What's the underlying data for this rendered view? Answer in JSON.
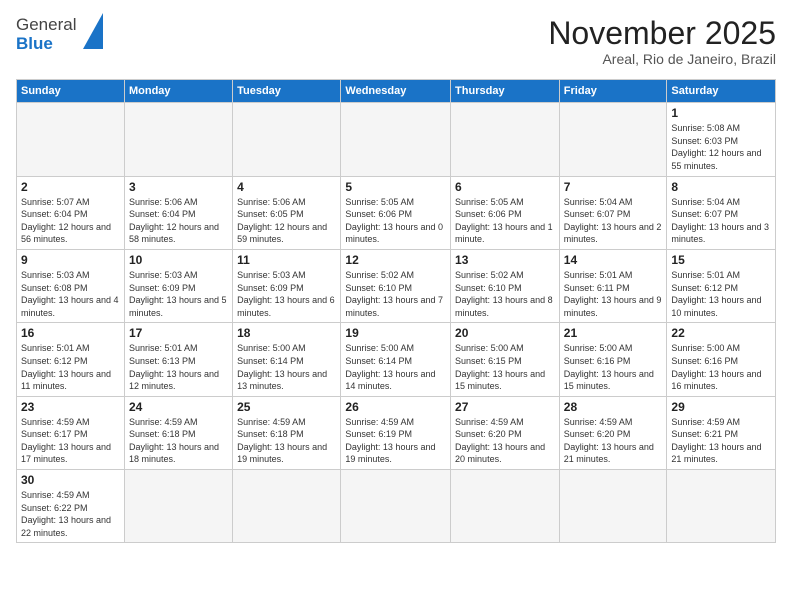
{
  "logo": {
    "line1": "General",
    "line2": "Blue"
  },
  "title": "November 2025",
  "subtitle": "Areal, Rio de Janeiro, Brazil",
  "weekdays": [
    "Sunday",
    "Monday",
    "Tuesday",
    "Wednesday",
    "Thursday",
    "Friday",
    "Saturday"
  ],
  "weeks": [
    [
      {
        "day": "",
        "info": ""
      },
      {
        "day": "",
        "info": ""
      },
      {
        "day": "",
        "info": ""
      },
      {
        "day": "",
        "info": ""
      },
      {
        "day": "",
        "info": ""
      },
      {
        "day": "",
        "info": ""
      },
      {
        "day": "1",
        "info": "Sunrise: 5:08 AM\nSunset: 6:03 PM\nDaylight: 12 hours and 55 minutes."
      }
    ],
    [
      {
        "day": "2",
        "info": "Sunrise: 5:07 AM\nSunset: 6:04 PM\nDaylight: 12 hours and 56 minutes."
      },
      {
        "day": "3",
        "info": "Sunrise: 5:06 AM\nSunset: 6:04 PM\nDaylight: 12 hours and 58 minutes."
      },
      {
        "day": "4",
        "info": "Sunrise: 5:06 AM\nSunset: 6:05 PM\nDaylight: 12 hours and 59 minutes."
      },
      {
        "day": "5",
        "info": "Sunrise: 5:05 AM\nSunset: 6:06 PM\nDaylight: 13 hours and 0 minutes."
      },
      {
        "day": "6",
        "info": "Sunrise: 5:05 AM\nSunset: 6:06 PM\nDaylight: 13 hours and 1 minute."
      },
      {
        "day": "7",
        "info": "Sunrise: 5:04 AM\nSunset: 6:07 PM\nDaylight: 13 hours and 2 minutes."
      },
      {
        "day": "8",
        "info": "Sunrise: 5:04 AM\nSunset: 6:07 PM\nDaylight: 13 hours and 3 minutes."
      }
    ],
    [
      {
        "day": "9",
        "info": "Sunrise: 5:03 AM\nSunset: 6:08 PM\nDaylight: 13 hours and 4 minutes."
      },
      {
        "day": "10",
        "info": "Sunrise: 5:03 AM\nSunset: 6:09 PM\nDaylight: 13 hours and 5 minutes."
      },
      {
        "day": "11",
        "info": "Sunrise: 5:03 AM\nSunset: 6:09 PM\nDaylight: 13 hours and 6 minutes."
      },
      {
        "day": "12",
        "info": "Sunrise: 5:02 AM\nSunset: 6:10 PM\nDaylight: 13 hours and 7 minutes."
      },
      {
        "day": "13",
        "info": "Sunrise: 5:02 AM\nSunset: 6:10 PM\nDaylight: 13 hours and 8 minutes."
      },
      {
        "day": "14",
        "info": "Sunrise: 5:01 AM\nSunset: 6:11 PM\nDaylight: 13 hours and 9 minutes."
      },
      {
        "day": "15",
        "info": "Sunrise: 5:01 AM\nSunset: 6:12 PM\nDaylight: 13 hours and 10 minutes."
      }
    ],
    [
      {
        "day": "16",
        "info": "Sunrise: 5:01 AM\nSunset: 6:12 PM\nDaylight: 13 hours and 11 minutes."
      },
      {
        "day": "17",
        "info": "Sunrise: 5:01 AM\nSunset: 6:13 PM\nDaylight: 13 hours and 12 minutes."
      },
      {
        "day": "18",
        "info": "Sunrise: 5:00 AM\nSunset: 6:14 PM\nDaylight: 13 hours and 13 minutes."
      },
      {
        "day": "19",
        "info": "Sunrise: 5:00 AM\nSunset: 6:14 PM\nDaylight: 13 hours and 14 minutes."
      },
      {
        "day": "20",
        "info": "Sunrise: 5:00 AM\nSunset: 6:15 PM\nDaylight: 13 hours and 15 minutes."
      },
      {
        "day": "21",
        "info": "Sunrise: 5:00 AM\nSunset: 6:16 PM\nDaylight: 13 hours and 15 minutes."
      },
      {
        "day": "22",
        "info": "Sunrise: 5:00 AM\nSunset: 6:16 PM\nDaylight: 13 hours and 16 minutes."
      }
    ],
    [
      {
        "day": "23",
        "info": "Sunrise: 4:59 AM\nSunset: 6:17 PM\nDaylight: 13 hours and 17 minutes."
      },
      {
        "day": "24",
        "info": "Sunrise: 4:59 AM\nSunset: 6:18 PM\nDaylight: 13 hours and 18 minutes."
      },
      {
        "day": "25",
        "info": "Sunrise: 4:59 AM\nSunset: 6:18 PM\nDaylight: 13 hours and 19 minutes."
      },
      {
        "day": "26",
        "info": "Sunrise: 4:59 AM\nSunset: 6:19 PM\nDaylight: 13 hours and 19 minutes."
      },
      {
        "day": "27",
        "info": "Sunrise: 4:59 AM\nSunset: 6:20 PM\nDaylight: 13 hours and 20 minutes."
      },
      {
        "day": "28",
        "info": "Sunrise: 4:59 AM\nSunset: 6:20 PM\nDaylight: 13 hours and 21 minutes."
      },
      {
        "day": "29",
        "info": "Sunrise: 4:59 AM\nSunset: 6:21 PM\nDaylight: 13 hours and 21 minutes."
      }
    ],
    [
      {
        "day": "30",
        "info": "Sunrise: 4:59 AM\nSunset: 6:22 PM\nDaylight: 13 hours and 22 minutes."
      },
      {
        "day": "",
        "info": ""
      },
      {
        "day": "",
        "info": ""
      },
      {
        "day": "",
        "info": ""
      },
      {
        "day": "",
        "info": ""
      },
      {
        "day": "",
        "info": ""
      },
      {
        "day": "",
        "info": ""
      }
    ]
  ]
}
